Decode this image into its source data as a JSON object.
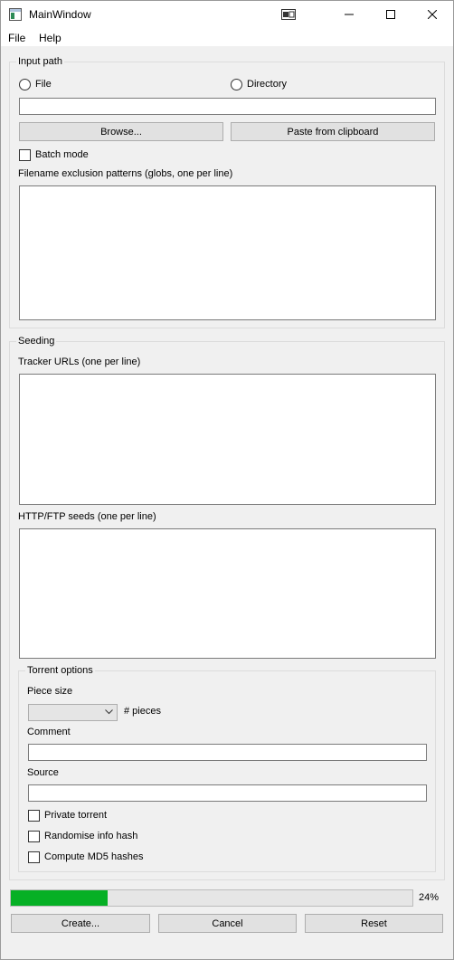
{
  "window": {
    "title": "MainWindow"
  },
  "menu": {
    "file": "File",
    "help": "Help"
  },
  "input_path": {
    "group_title": "Input path",
    "file_radio": "File",
    "directory_radio": "Directory",
    "path_value": "",
    "browse_button": "Browse...",
    "paste_button": "Paste from clipboard",
    "batch_mode": "Batch mode",
    "exclusion_label": "Filename exclusion patterns (globs, one per line)",
    "exclusion_value": ""
  },
  "seeding": {
    "group_title": "Seeding",
    "tracker_label": "Tracker URLs (one per line)",
    "tracker_value": "",
    "seeds_label": "HTTP/FTP seeds (one per line)",
    "seeds_value": ""
  },
  "torrent_options": {
    "group_title": "Torrent options",
    "piece_size_label": "Piece size",
    "piece_size_value": "",
    "pieces_label": "# pieces",
    "comment_label": "Comment",
    "comment_value": "",
    "source_label": "Source",
    "source_value": "",
    "private_torrent": "Private torrent",
    "randomise_hash": "Randomise info hash",
    "compute_md5": "Compute MD5 hashes"
  },
  "progress": {
    "value_percent": 24,
    "label": "24%",
    "fill_color": "#06b025"
  },
  "buttons": {
    "create": "Create...",
    "cancel": "Cancel",
    "reset": "Reset"
  }
}
